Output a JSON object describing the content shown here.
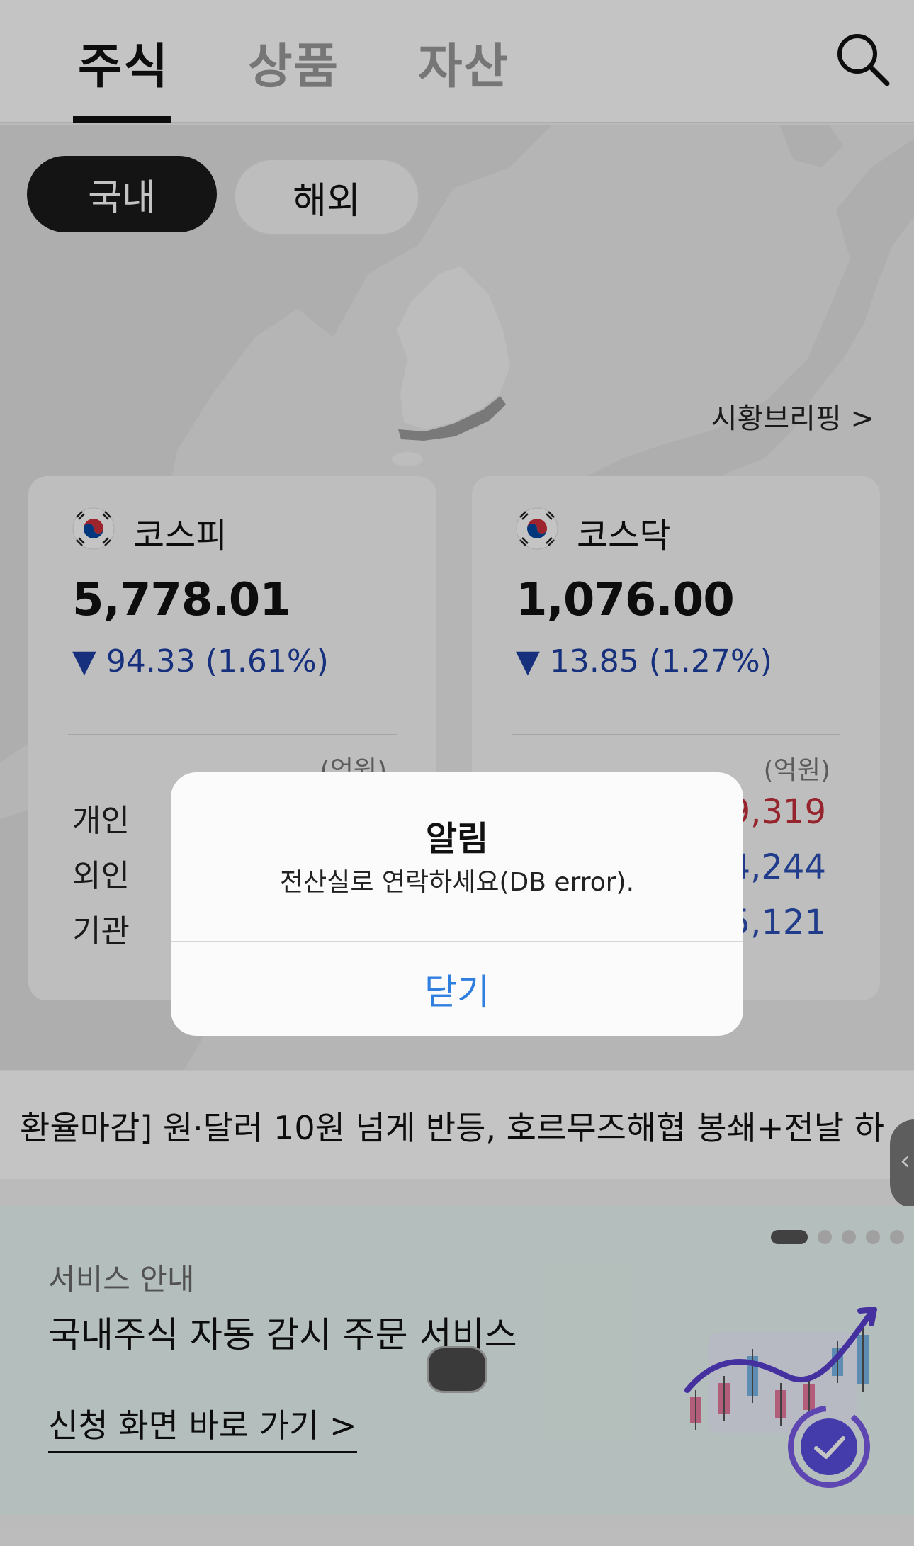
{
  "header": {
    "tabs": [
      "주식",
      "상품",
      "자산"
    ],
    "active_tab_index": 0
  },
  "market": {
    "toggle": [
      "국내",
      "해외"
    ],
    "briefing_link": "시황브리핑 >",
    "indices": [
      {
        "name": "코스피",
        "value": "5,778.01",
        "change": "▼ 94.33  (1.61%)",
        "unit": "(억원)",
        "investors": [
          {
            "label": "개인",
            "value": ""
          },
          {
            "label": "외인",
            "value": ""
          },
          {
            "label": "기관",
            "value": ""
          }
        ]
      },
      {
        "name": "코스닥",
        "value": "1,076.00",
        "change": "▼ 13.85  (1.27%)",
        "unit": "(억원)",
        "investors": [
          {
            "label": "",
            "value": "9,319"
          },
          {
            "label": "",
            "value": "4,244"
          },
          {
            "label": "",
            "value": "5,121"
          }
        ]
      }
    ]
  },
  "ticker": {
    "text": "환율마감] 원·달러 10원 넘게 반등, 호르무즈해협 봉쇄+전날 하",
    "handle_icon": "chevron-left-icon"
  },
  "banner": {
    "subtitle": "서비스 안내",
    "title": "국내주식 자동 감시 주문 서비스",
    "link": "신청 화면 바로 가기 >",
    "page_count": 5,
    "active_page": 0
  },
  "dialog": {
    "title": "알림",
    "message": "전산실로 연락하세요(DB error).",
    "button": "닫기"
  },
  "colors": {
    "accent_blue": "#2f7fe0",
    "down_blue": "#1d3fa3",
    "up_red": "#c4303a",
    "pill_dark": "#1a1a1a"
  }
}
